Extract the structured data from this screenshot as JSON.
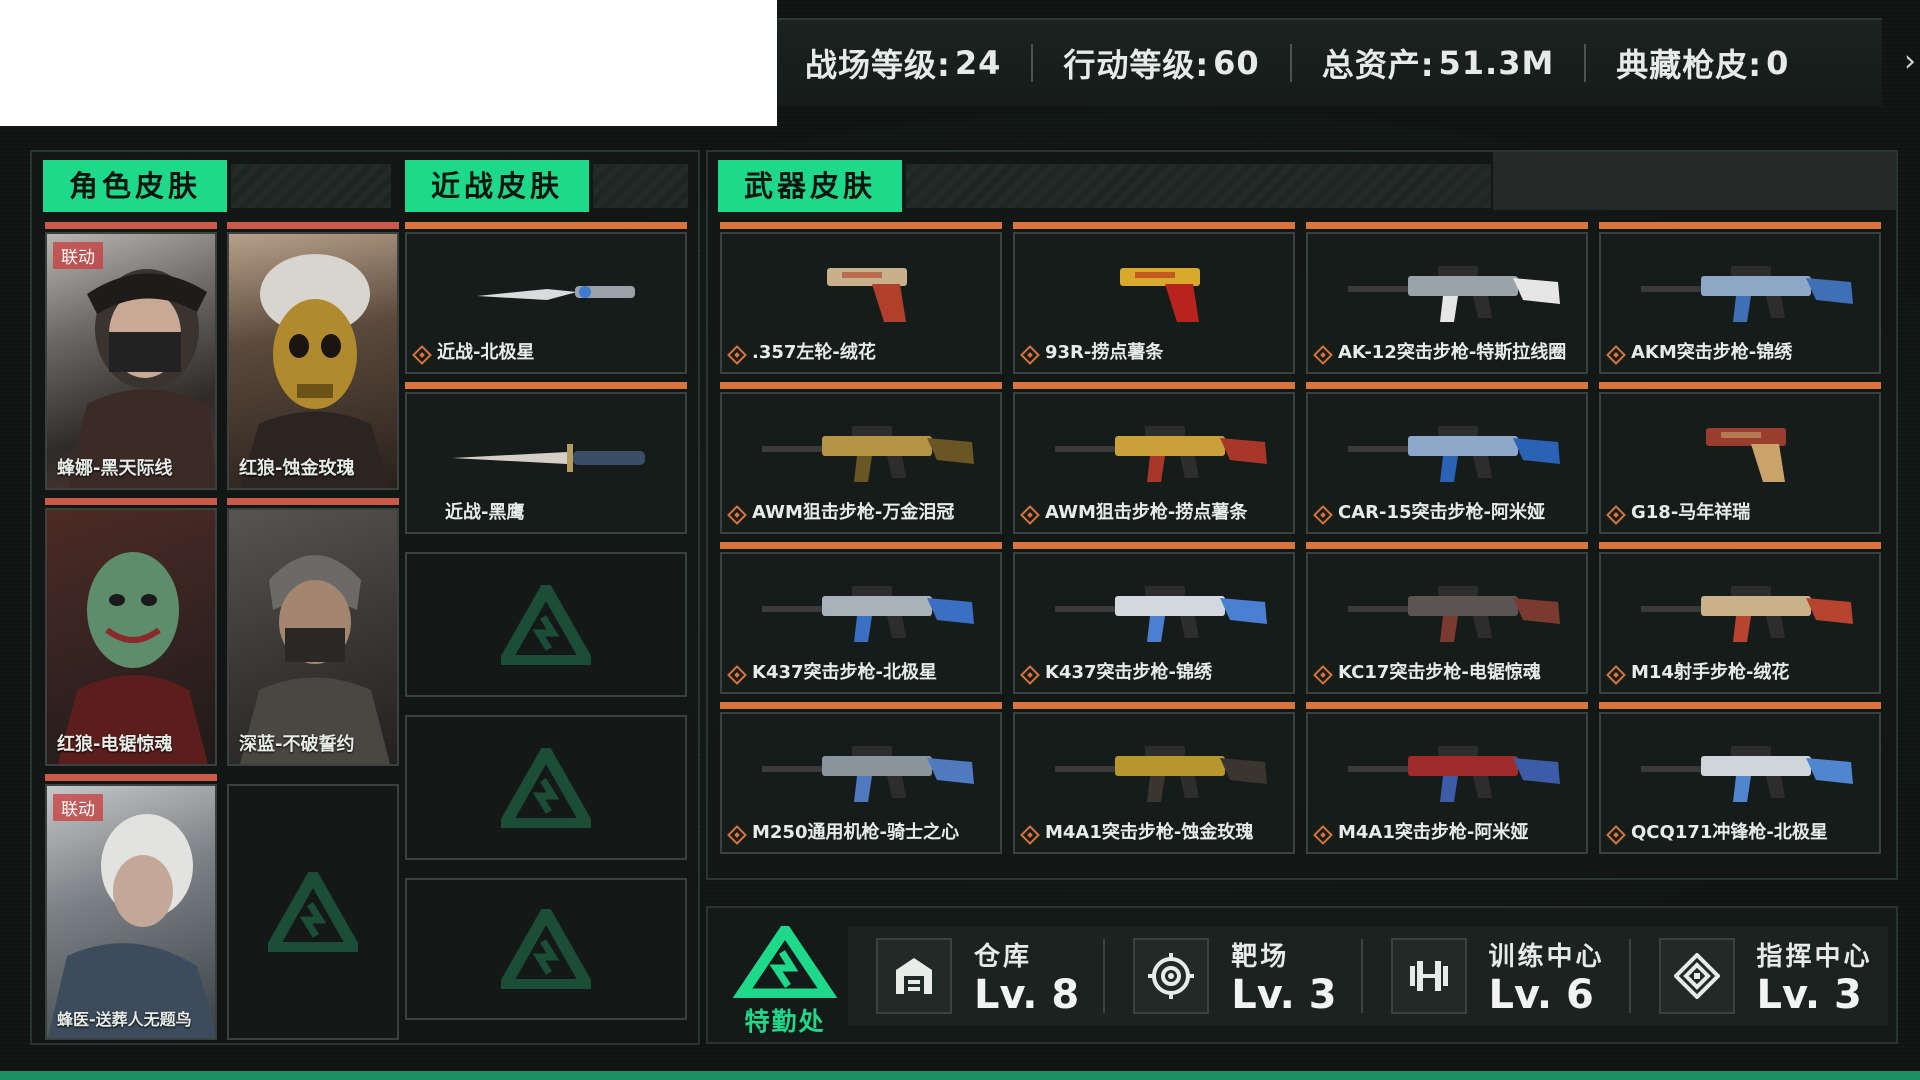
{
  "stats": {
    "battlefield_label": "战场等级:",
    "battlefield_value": "24",
    "action_label": "行动等级:",
    "action_value": "60",
    "assets_label": "总资产:",
    "assets_value": "51.3M",
    "collection_label": "典藏枪皮:",
    "collection_value": "0"
  },
  "sections": {
    "character": "角色皮肤",
    "melee": "近战皮肤",
    "weapon": "武器皮肤"
  },
  "character_skins": [
    {
      "label": "蜂娜-黑天际线",
      "tag": "联动"
    },
    {
      "label": "红狼-蚀金玫瑰",
      "tag": ""
    },
    {
      "label": "红狼-电锯惊魂",
      "tag": ""
    },
    {
      "label": "深蓝-不破誓约",
      "tag": ""
    },
    {
      "label": "蜂医-送葬人无题鸟",
      "tag": "联动"
    }
  ],
  "melee_skins": [
    {
      "label": "近战-北极星"
    },
    {
      "label": "近战-黑鹰"
    }
  ],
  "weapon_skins": [
    {
      "label": ".357左轮-绒花"
    },
    {
      "label": "93R-捞点薯条"
    },
    {
      "label": "AK-12突击步枪-特斯拉线圈"
    },
    {
      "label": "AKM突击步枪-锦绣"
    },
    {
      "label": "AWM狙击步枪-万金泪冠"
    },
    {
      "label": "AWM狙击步枪-捞点薯条"
    },
    {
      "label": "CAR-15突击步枪-阿米娅"
    },
    {
      "label": "G18-马年祥瑞"
    },
    {
      "label": "K437突击步枪-北极星"
    },
    {
      "label": "K437突击步枪-锦绣"
    },
    {
      "label": "KC17突击步枪-电锯惊魂"
    },
    {
      "label": "M14射手步枪-绒花"
    },
    {
      "label": "M250通用机枪-骑士之心"
    },
    {
      "label": "M4A1突击步枪-蚀金玫瑰"
    },
    {
      "label": "M4A1突击步枪-阿米娅"
    },
    {
      "label": "QCQ171冲锋枪-北极星"
    }
  ],
  "facilities": {
    "hq_label": "特勤处",
    "items": [
      {
        "name": "仓库",
        "level": "Lv. 8",
        "icon": "warehouse-icon"
      },
      {
        "name": "靶场",
        "level": "Lv. 3",
        "icon": "target-icon"
      },
      {
        "name": "训练中心",
        "level": "Lv. 6",
        "icon": "dumbbell-icon"
      },
      {
        "name": "指挥中心",
        "level": "Lv. 3",
        "icon": "command-icon"
      }
    ]
  },
  "colors": {
    "accent": "#1fd98a",
    "card_top": "#d9743a",
    "character_top": "#c85a4a"
  }
}
